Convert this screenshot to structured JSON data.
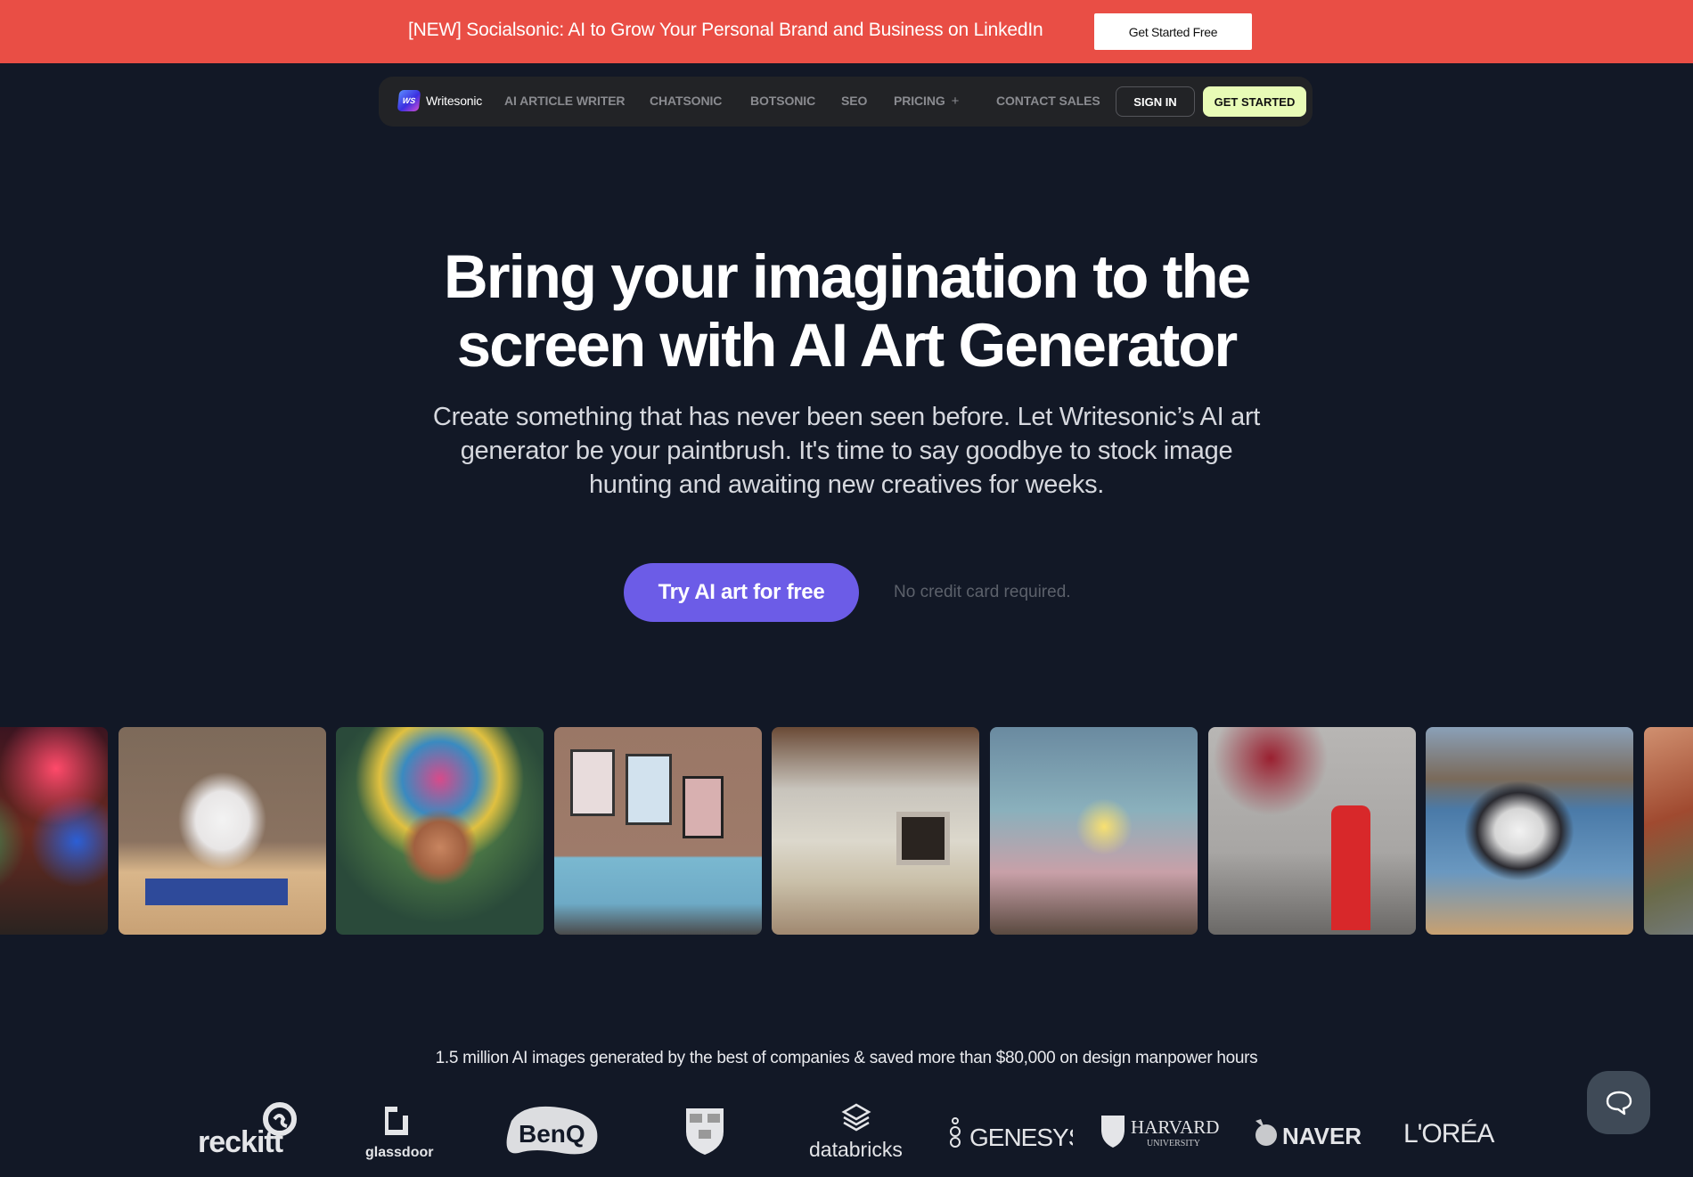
{
  "announcement": {
    "text": "[NEW] Socialsonic: AI to Grow Your Personal Brand and Business on LinkedIn",
    "button_label": "Get Started Free",
    "bg_color": "#e94e45"
  },
  "nav": {
    "logo_mark": "WS",
    "logo_text": "Writesonic",
    "items": [
      {
        "label": "AI ARTICLE WRITER"
      },
      {
        "label": "CHATSONIC"
      },
      {
        "label": "BOTSONIC"
      },
      {
        "label": "SEO"
      },
      {
        "label": "PRICING",
        "icon": "sparkle-plus-icon"
      },
      {
        "label": "CONTACT SALES"
      }
    ],
    "sign_in_label": "SIGN IN",
    "get_started_label": "GET STARTED",
    "accent_color": "#e8fbb6"
  },
  "hero": {
    "title_line1": "Bring your imagination to the",
    "title_line2": "screen with AI Art Generator",
    "subtitle_line1": "Create something that has never been seen before. Let Writesonic’s AI art",
    "subtitle_line2": "generator be your paintbrush. It's time to say goodbye to stock image",
    "subtitle_line3": "hunting and awaiting new creatives for weeks.",
    "cta_label": "Try AI art for free",
    "cta_note": "No credit card required.",
    "cta_color": "#6c5ce7"
  },
  "gallery": {
    "images": [
      {
        "name": "rabbit-cyclist-neon-city"
      },
      {
        "name": "rainbow-unicorn-figurine"
      },
      {
        "name": "aztec-woman-headdress"
      },
      {
        "name": "blue-sofa-living-room"
      },
      {
        "name": "vaulted-living-room"
      },
      {
        "name": "pastel-bedroom"
      },
      {
        "name": "red-phone-booth-fog"
      },
      {
        "name": "husky-splashing-beach"
      },
      {
        "name": "mountain-sunset-landscape"
      }
    ]
  },
  "stats": {
    "text": "1.5 million AI images generated by the best of companies & saved more than $80,000 on design manpower hours"
  },
  "logos": {
    "items": [
      "reckitt",
      "glassdoor",
      "BenQ",
      "Harvard shield",
      "databricks",
      "GENESYS",
      "HARVARD",
      "UNIVERSITY",
      "NAVER",
      "L'ORÉA"
    ]
  },
  "chat": {
    "icon": "chat-bubble-icon"
  }
}
